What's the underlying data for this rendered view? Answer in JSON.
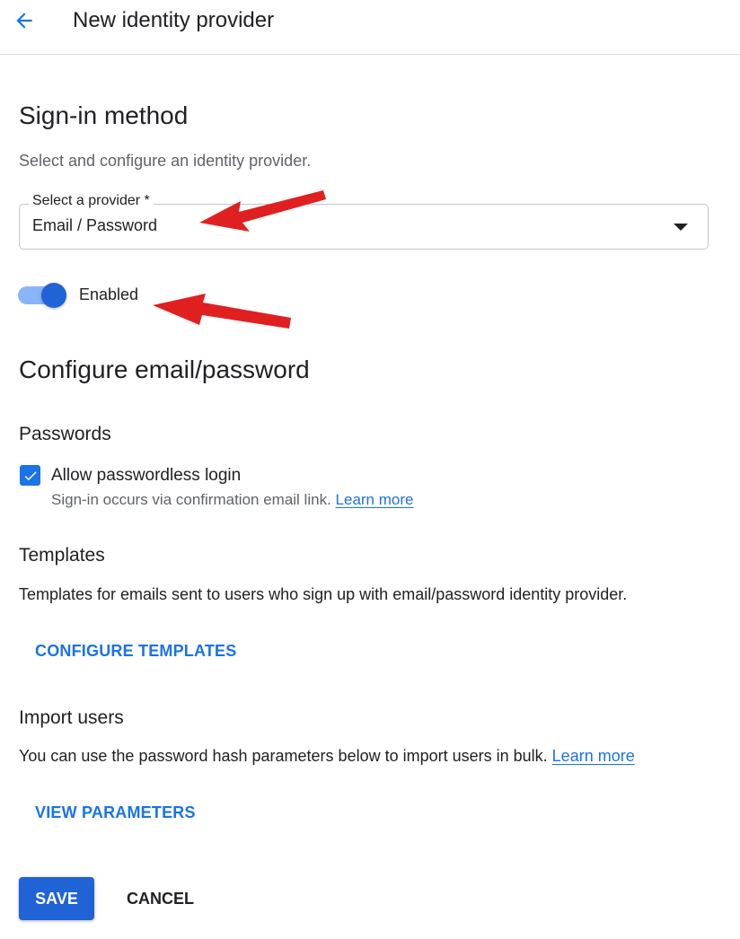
{
  "header": {
    "title": "New identity provider",
    "back_icon": "arrow-back-icon"
  },
  "signin": {
    "heading": "Sign-in method",
    "description": "Select and configure an identity provider.",
    "provider_label": "Select a provider *",
    "provider_value": "Email / Password",
    "enabled_label": "Enabled",
    "enabled": true
  },
  "configure": {
    "heading": "Configure email/password",
    "passwords": {
      "heading": "Passwords",
      "checkbox_label": "Allow passwordless login",
      "checked": true,
      "help_text": "Sign-in occurs via confirmation email link.",
      "help_link": "Learn more"
    },
    "templates": {
      "heading": "Templates",
      "description": "Templates for emails sent to users who sign up with email/password identity provider.",
      "button": "CONFIGURE TEMPLATES"
    },
    "import": {
      "heading": "Import users",
      "description": "You can use the password hash parameters below to import users in bulk.",
      "link": "Learn more",
      "button": "VIEW PARAMETERS"
    }
  },
  "actions": {
    "save": "SAVE",
    "cancel": "CANCEL"
  },
  "colors": {
    "accent": "#1a73e8",
    "primary_button": "#1f63d6",
    "annotation_arrow": "#e02020"
  }
}
